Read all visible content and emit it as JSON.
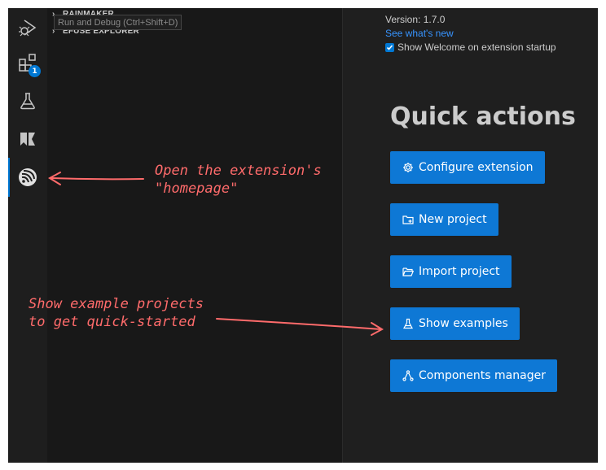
{
  "sidebar": {
    "sections": [
      {
        "label": "RAINMAKER"
      },
      {
        "label": "EFUSE EXPLORER"
      }
    ],
    "tooltip": "Run and Debug (Ctrl+Shift+D)"
  },
  "activity_bar": {
    "items": [
      {
        "icon": "run-debug-icon"
      },
      {
        "icon": "extensions-icon",
        "badge": "1"
      },
      {
        "icon": "testing-flask-icon"
      },
      {
        "icon": "bookmark-flags-icon"
      },
      {
        "icon": "espressif-icon",
        "active": true
      }
    ]
  },
  "welcome": {
    "version": "Version: 1.7.0",
    "whats_new": "See what's new",
    "show_on_startup": "Show Welcome on extension startup",
    "show_on_startup_checked": true,
    "quick_actions_title": "Quick actions",
    "buttons": [
      {
        "label": "Configure extension",
        "icon": "gear-icon"
      },
      {
        "label": "New project",
        "icon": "new-folder-icon"
      },
      {
        "label": "Import project",
        "icon": "folder-open-icon"
      },
      {
        "label": "Show examples",
        "icon": "flask-icon"
      },
      {
        "label": "Components manager",
        "icon": "components-icon"
      }
    ]
  },
  "annotations": {
    "homepage_note": "Open the extension's\n\"homepage\"",
    "examples_note": "Show example projects\nto get quick-started",
    "color": "#ff6b6b"
  }
}
